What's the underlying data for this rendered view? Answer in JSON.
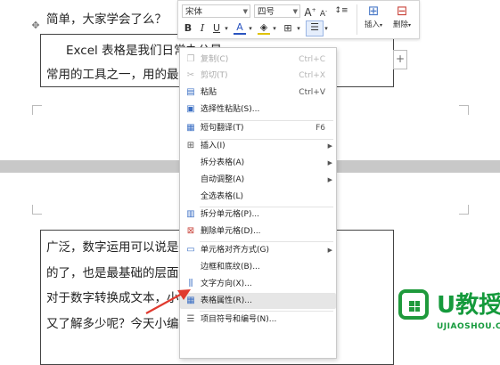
{
  "document": {
    "line1": "简单，大家学会了么？",
    "line2": "Excel 表格是我们日常办公最",
    "line3": "常用的工具之一，用的最广",
    "bottom_lines": [
      "广泛，数字运用可以说是",
      "的了，也是最基础的层面",
      "对于数字转换成文本，小",
      "又了解多少呢？今天小编"
    ],
    "move_handle_icon": "move-icon",
    "add_column": "+"
  },
  "toolbar": {
    "font_name": "宋体",
    "font_size": "四号",
    "increase_font": "A",
    "decrease_font": "A",
    "spacing": "↕≡",
    "bold": "B",
    "italic": "I",
    "underline": "U",
    "font_color": "A",
    "highlight": "A",
    "insert_label": "插入",
    "delete_label": "删除"
  },
  "context_menu": {
    "items": [
      {
        "icon": "copy-icon",
        "label": "复制(C)",
        "shortcut": "Ctrl+C",
        "disabled": true
      },
      {
        "icon": "cut-icon",
        "label": "剪切(T)",
        "shortcut": "Ctrl+X",
        "disabled": true
      },
      {
        "icon": "paste-icon",
        "label": "粘贴",
        "shortcut": "Ctrl+V",
        "disabled": false
      },
      {
        "icon": "paste-special-icon",
        "label": "选择性粘贴(S)...",
        "shortcut": "",
        "disabled": false
      },
      {
        "icon": "translate-icon",
        "label": "短句翻译(T)",
        "shortcut": "F6",
        "disabled": false
      },
      {
        "icon": "insert-table-icon",
        "label": "插入(I)",
        "submenu": true
      },
      {
        "icon": "",
        "label": "拆分表格(A)",
        "submenu": true
      },
      {
        "icon": "",
        "label": "自动调整(A)",
        "submenu": true
      },
      {
        "icon": "",
        "label": "全选表格(L)"
      },
      {
        "icon": "split-cell-icon",
        "label": "拆分单元格(P)..."
      },
      {
        "icon": "delete-cell-icon",
        "label": "删除单元格(D)..."
      },
      {
        "icon": "cell-align-icon",
        "label": "单元格对齐方式(G)",
        "submenu": true
      },
      {
        "icon": "",
        "label": "边框和底纹(B)..."
      },
      {
        "icon": "text-direction-icon",
        "label": "文字方向(X)..."
      },
      {
        "icon": "table-properties-icon",
        "label": "表格属性(R)...",
        "hover": true
      },
      {
        "icon": "list-numbering-icon",
        "label": "项目符号和编号(N)..."
      }
    ]
  },
  "watermark": {
    "title": "U教授",
    "url": "UJIAOSHOU.COM",
    "logo_icon": "windows-logo-icon"
  },
  "colors": {
    "accent": "#3b6fc4",
    "watermark_green": "#159a3c",
    "arrow_red": "#e03a2f"
  }
}
